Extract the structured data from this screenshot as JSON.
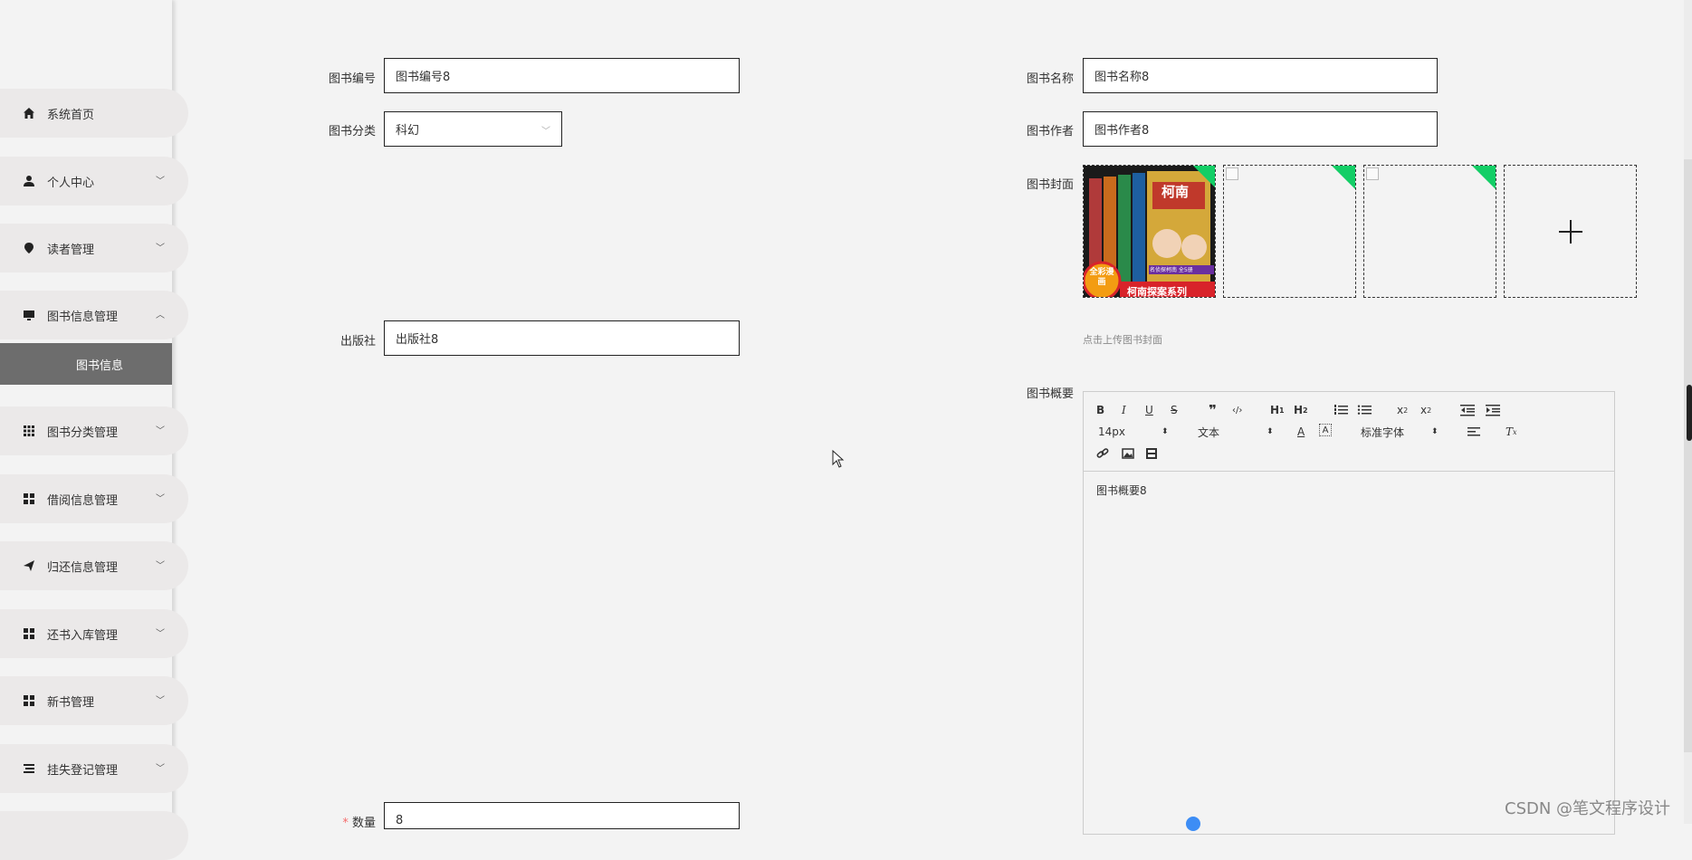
{
  "sidebar": {
    "items": [
      {
        "label": "系统首页",
        "icon": "home-icon"
      },
      {
        "label": "个人中心",
        "icon": "user-icon"
      },
      {
        "label": "读者管理",
        "icon": "location-pin-icon"
      },
      {
        "label": "图书信息管理",
        "icon": "monitor-icon"
      },
      {
        "label": "图书分类管理",
        "icon": "grid-icon"
      },
      {
        "label": "借阅信息管理",
        "icon": "apps-icon"
      },
      {
        "label": "归还信息管理",
        "icon": "send-icon"
      },
      {
        "label": "还书入库管理",
        "icon": "apps-icon"
      },
      {
        "label": "新书管理",
        "icon": "apps-icon"
      },
      {
        "label": "挂失登记管理",
        "icon": "list-icon"
      }
    ],
    "sub_item": "图书信息"
  },
  "form": {
    "book_no_label": "图书编号",
    "book_no_value": "图书编号8",
    "book_name_label": "图书名称",
    "book_name_value": "图书名称8",
    "category_label": "图书分类",
    "category_value": "科幻",
    "author_label": "图书作者",
    "author_value": "图书作者8",
    "cover_label": "图书封面",
    "cover_hint": "点击上传图书封面",
    "publisher_label": "出版社",
    "publisher_value": "出版社8",
    "summary_label": "图书概要",
    "summary_value": "图书概要8",
    "quantity_required": "*",
    "quantity_label": "数量",
    "quantity_value": "8"
  },
  "cover_image": {
    "title": "柯南",
    "badge": "全彩漫画",
    "series": "柯南探案系列",
    "subtitle": "名侦探柯南 全5册"
  },
  "editor": {
    "font_size": "14px",
    "text_type": "文本",
    "font_family": "标准字体"
  },
  "watermark": "CSDN @笔文程序设计",
  "colors": {
    "success_tag": "#13ce66",
    "active_menu": "#6d6d6d"
  }
}
